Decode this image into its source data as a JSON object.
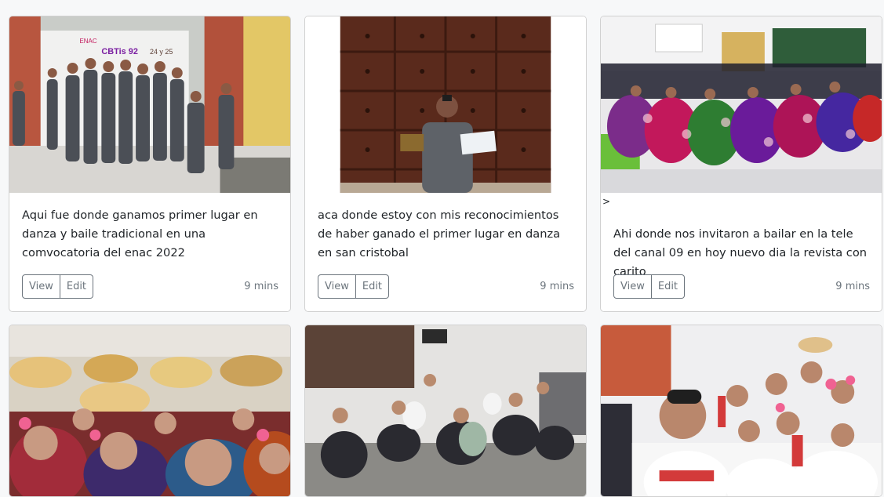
{
  "cards": [
    {
      "caption": "Aqui fue donde ganamos primer lugar en danza y baile tradicional en una comvocatoria del enac 2022",
      "view_label": "View",
      "edit_label": "Edit",
      "time": "9 mins",
      "banner_logo_text": "CBTis 92",
      "banner_date_text": "24 y 25"
    },
    {
      "caption": "aca donde estoy con mis reconocimientos de haber ganado el primer lugar en danza en san cristobal",
      "view_label": "View",
      "edit_label": "Edit",
      "time": "9 mins"
    },
    {
      "prefix": ">",
      "caption": "Ahi donde nos invitaron a bailar en la tele del canal 09 en hoy nuevo dia la revista con carito",
      "view_label": "View",
      "edit_label": "Edit",
      "time": "9 mins"
    },
    {
      "caption": ""
    },
    {
      "caption": ""
    },
    {
      "caption": ""
    }
  ],
  "colors": {
    "page_bg": "#f7f8f9",
    "card_border": "#cfd2d5",
    "button_text": "#6c757d",
    "text": "#212529"
  }
}
